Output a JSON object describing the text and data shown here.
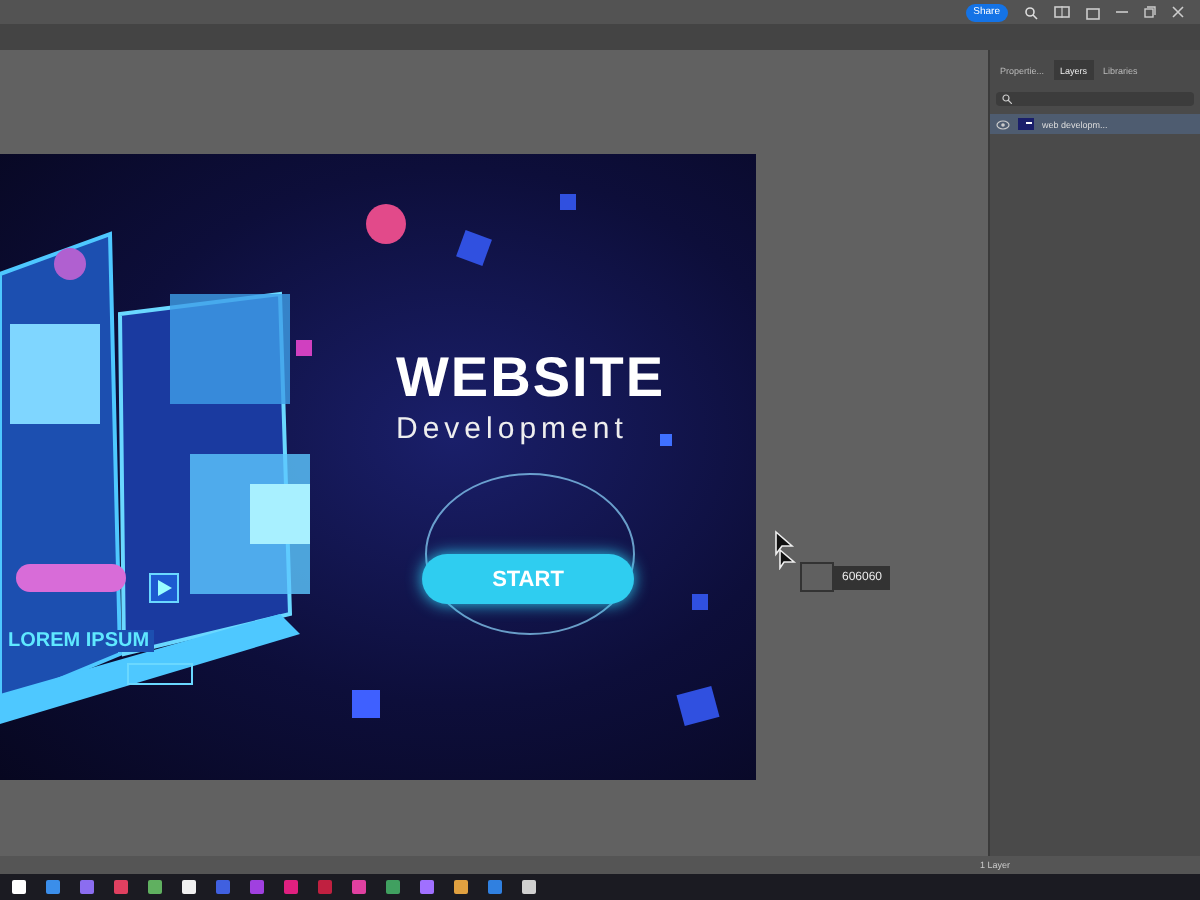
{
  "app_bar": {
    "share_button": "Share"
  },
  "panel": {
    "tabs": [
      {
        "label": "Propertie...",
        "selected": false
      },
      {
        "label": "Layers",
        "selected": true
      },
      {
        "label": "Libraries",
        "selected": false
      }
    ],
    "layers": [
      {
        "name": "web developm...",
        "visible": true,
        "selected": true
      }
    ]
  },
  "document": {
    "title": "WEBSITE",
    "subtitle": "Development",
    "button": "START",
    "side_label": "LOREM IPSUM"
  },
  "color_tooltip": {
    "value": "606060"
  },
  "status_bar": {
    "layer_count": "1 Layer"
  }
}
